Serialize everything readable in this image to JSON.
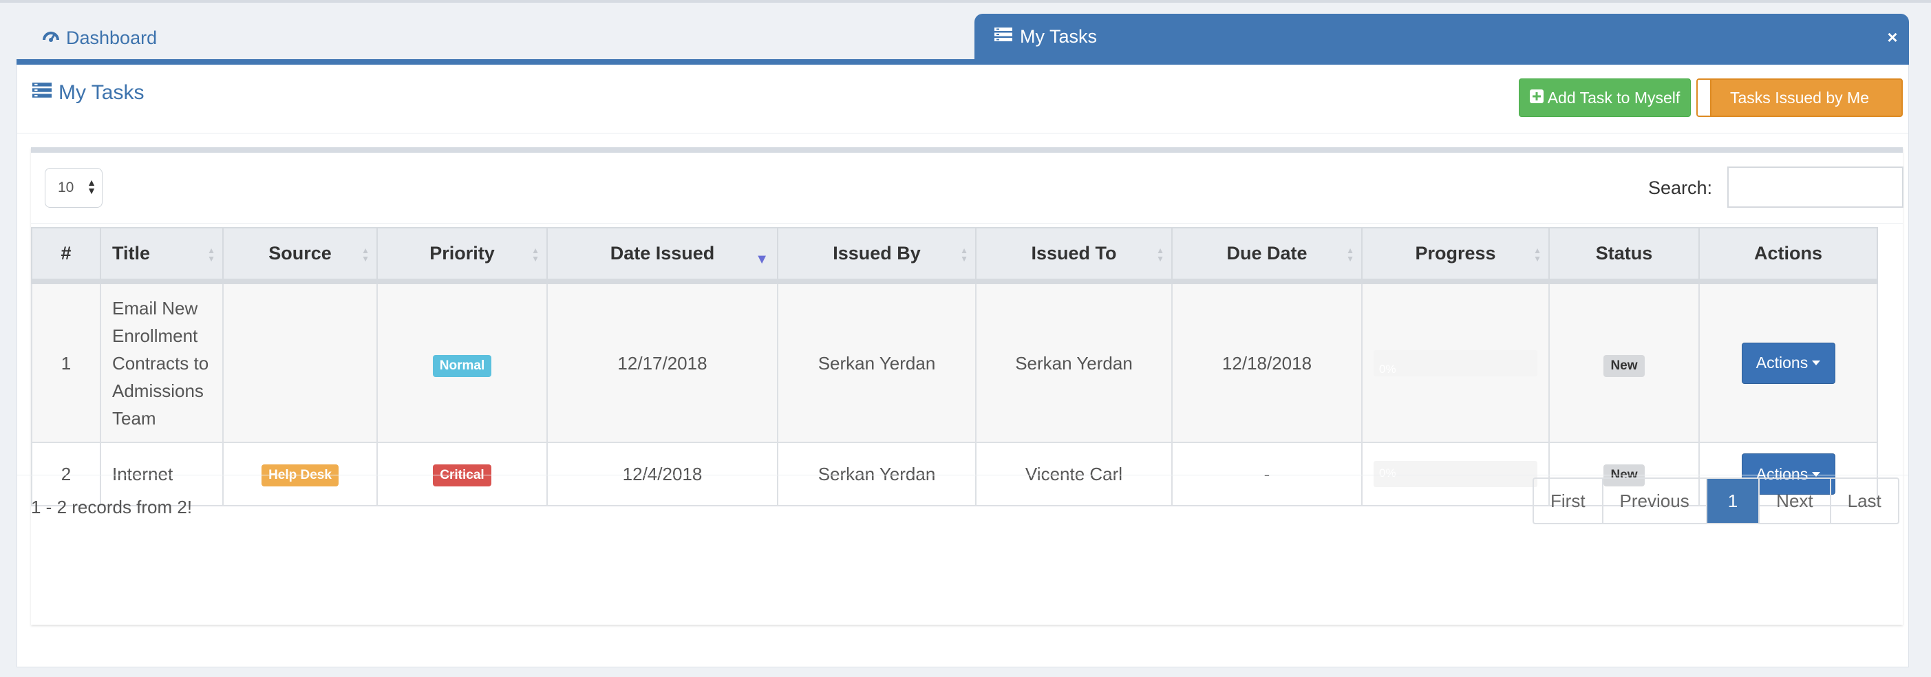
{
  "tabs": {
    "dashboard_label": "Dashboard",
    "active_label": "My Tasks",
    "close_glyph": "×"
  },
  "panel": {
    "title": "My Tasks",
    "add_task_label": "Add Task to Myself",
    "issued_by_me_label": "Tasks Issued by Me"
  },
  "table_controls": {
    "page_length": "10",
    "search_label": "Search:",
    "search_value": ""
  },
  "columns": [
    "#",
    "Title",
    "Source",
    "Priority",
    "Date Issued",
    "Issued By",
    "Issued To",
    "Due Date",
    "Progress",
    "Status",
    "Actions"
  ],
  "sorted_column": "Date Issued",
  "rows": [
    {
      "num": "1",
      "title": "Email New Enrollment Contracts to Admissions Team",
      "source": "",
      "priority": "Normal",
      "date_issued": "12/17/2018",
      "issued_by": "Serkan Yerdan",
      "issued_to": "Serkan Yerdan",
      "due_date": "12/18/2018",
      "progress_text": "0%",
      "progress": 0,
      "status": "New",
      "actions_label": "Actions"
    },
    {
      "num": "2",
      "title": "Internet",
      "source": "Help Desk",
      "priority": "Critical",
      "date_issued": "12/4/2018",
      "issued_by": "Serkan Yerdan",
      "issued_to": "Vicente Carl",
      "due_date": "-",
      "progress_text": "0%",
      "progress": 0,
      "status": "New",
      "actions_label": "Actions"
    }
  ],
  "footer": {
    "records_text": "1 - 2 records from 2!",
    "pagination": {
      "first": "First",
      "previous": "Previous",
      "current": "1",
      "next": "Next",
      "last": "Last"
    }
  },
  "colors": {
    "primary": "#4277b3",
    "success": "#5cb85c",
    "warning": "#e99b39",
    "info": "#5bc0de",
    "danger": "#d9534f"
  }
}
